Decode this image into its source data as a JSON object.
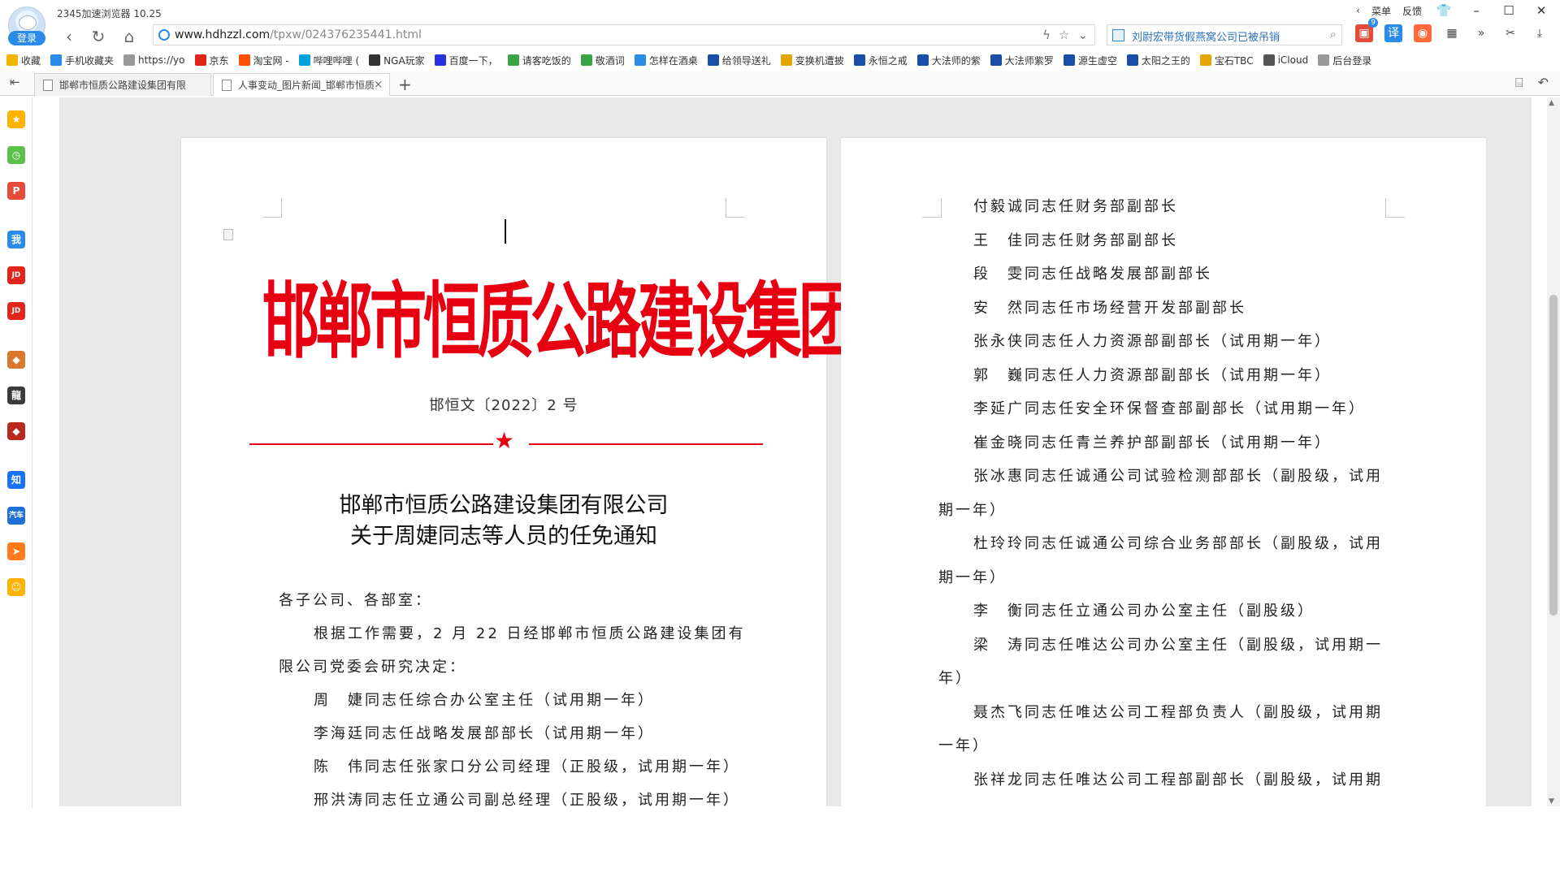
{
  "browser": {
    "app_title": "2345加速浏览器 10.25",
    "login_label": "登录",
    "menu_label": "菜单",
    "feedback_label": "反馈",
    "url_host": "www.hdhzzl.com",
    "url_path": "/tpxw/024376235441.html",
    "search_text": "刘尉宏带货假燕窝公司已被吊销",
    "badge_count": "9"
  },
  "bookmarks": [
    {
      "label": "收藏",
      "icon": "star-icon",
      "color": "#f5b400"
    },
    {
      "label": "手机收藏夹",
      "icon": "phone-icon",
      "color": "#2a8ce6"
    },
    {
      "label": "https://yo",
      "icon": "page-icon",
      "color": "#999999"
    },
    {
      "label": "京东",
      "icon": "jd-icon",
      "color": "#e1251b"
    },
    {
      "label": "淘宝网 -",
      "icon": "taobao-icon",
      "color": "#ff5000"
    },
    {
      "label": "哔哩哔哩 (",
      "icon": "bilibili-icon",
      "color": "#00a1d6"
    },
    {
      "label": "NGA玩家",
      "icon": "nga-icon",
      "color": "#333333"
    },
    {
      "label": "百度一下，",
      "icon": "baidu-icon",
      "color": "#2932e1"
    },
    {
      "label": "请客吃饭的",
      "icon": "green-icon",
      "color": "#3aa342"
    },
    {
      "label": "敬酒词",
      "icon": "green-icon",
      "color": "#3aa342"
    },
    {
      "label": "怎样在酒桌",
      "icon": "question-icon",
      "color": "#2a8ce6"
    },
    {
      "label": "给领导送礼",
      "icon": "w-icon",
      "color": "#1b4ea8"
    },
    {
      "label": "变换机遭披",
      "icon": "hat-icon",
      "color": "#e6a500"
    },
    {
      "label": "永恒之戒",
      "icon": "ring-icon",
      "color": "#1b4ea8"
    },
    {
      "label": "大法师的紫",
      "icon": "wow-icon",
      "color": "#1b4ea8"
    },
    {
      "label": "大法师紫罗",
      "icon": "w-icon",
      "color": "#1b4ea8"
    },
    {
      "label": "源生虚空",
      "icon": "wow-icon",
      "color": "#1b4ea8"
    },
    {
      "label": "太阳之王的",
      "icon": "wow-icon",
      "color": "#1b4ea8"
    },
    {
      "label": "宝石TBC",
      "icon": "hat-icon",
      "color": "#e6a500"
    },
    {
      "label": "iCloud",
      "icon": "apple-icon",
      "color": "#555555"
    },
    {
      "label": "后台登录",
      "icon": "page-icon",
      "color": "#999999"
    }
  ],
  "tabs": [
    {
      "label": "邯郸市恒质公路建设集团有限",
      "active": false
    },
    {
      "label": "人事变动_图片新闻_邯郸市恒质",
      "active": true
    }
  ],
  "document": {
    "red_title": "邯郸市恒质公路建设集团有限公司文件",
    "doc_number": "邯恒文〔2022〕2 号",
    "heading_line1": "邯郸市恒质公路建设集团有限公司",
    "heading_line2": "关于周婕同志等人员的任免通知",
    "left_paragraphs": [
      "各子公司、各部室：",
      "根据工作需要，2 月 22 日经邯郸市恒质公路建设集团有",
      "限公司党委会研究决定：",
      "周　婕同志任综合办公室主任（试用期一年）",
      "李海廷同志任战略发展部部长（试用期一年）",
      "陈　伟同志任张家口分公司经理（正股级，试用期一年）",
      "邢洪涛同志任立通公司副总经理（正股级，试用期一年）"
    ],
    "right_paragraphs": [
      "付毅诚同志任财务部副部长",
      "王　佳同志任财务部副部长",
      "段　雯同志任战略发展部副部长",
      "安　然同志任市场经营开发部副部长",
      "张永侠同志任人力资源部副部长（试用期一年）",
      "郭　巍同志任人力资源部副部长（试用期一年）",
      "李延广同志任安全环保督查部副部长（试用期一年）",
      "崔金晓同志任青兰养护部副部长（试用期一年）",
      "张冰惠同志任诚通公司试验检测部部长（副股级，试用",
      "期一年）",
      "杜玲玲同志任诚通公司综合业务部部长（副股级，试用",
      "期一年）",
      "李　衡同志任立通公司办公室主任（副股级）",
      "梁　涛同志任唯达公司办公室主任（副股级，试用期一",
      "年）",
      "聂杰飞同志任唯达公司工程部负责人（副股级，试用期",
      "一年）",
      "张祥龙同志任唯达公司工程部副部长（副股级，试用期"
    ]
  },
  "sidebar_icons": [
    {
      "name": "favorites-star-icon",
      "color": "#ffb300",
      "glyph": "★"
    },
    {
      "name": "history-clock-icon",
      "color": "#5cc14b",
      "glyph": "◷"
    },
    {
      "name": "pdf-word-icon",
      "color": "#e64a3b",
      "glyph": "P"
    },
    {
      "name": "me-icon",
      "color": "#2a8ce6",
      "glyph": "我"
    },
    {
      "name": "jd-icon",
      "color": "#e1251b",
      "glyph": "JD"
    },
    {
      "name": "jd-icon-2",
      "color": "#e1251b",
      "glyph": "JD"
    },
    {
      "name": "game-icon-1",
      "color": "#d9772c",
      "glyph": "◆"
    },
    {
      "name": "dragon-game-icon",
      "color": "#3b3b3b",
      "glyph": "龍"
    },
    {
      "name": "game-icon-2",
      "color": "#b8281d",
      "glyph": "◆"
    },
    {
      "name": "zhihu-icon",
      "color": "#1772f6",
      "glyph": "知"
    },
    {
      "name": "car-icon",
      "color": "#1e6fd6",
      "glyph": "汽车"
    },
    {
      "name": "send-icon",
      "color": "#ff7a1a",
      "glyph": "➤"
    },
    {
      "name": "smile-icon",
      "color": "#ffb300",
      "glyph": "☺"
    }
  ]
}
